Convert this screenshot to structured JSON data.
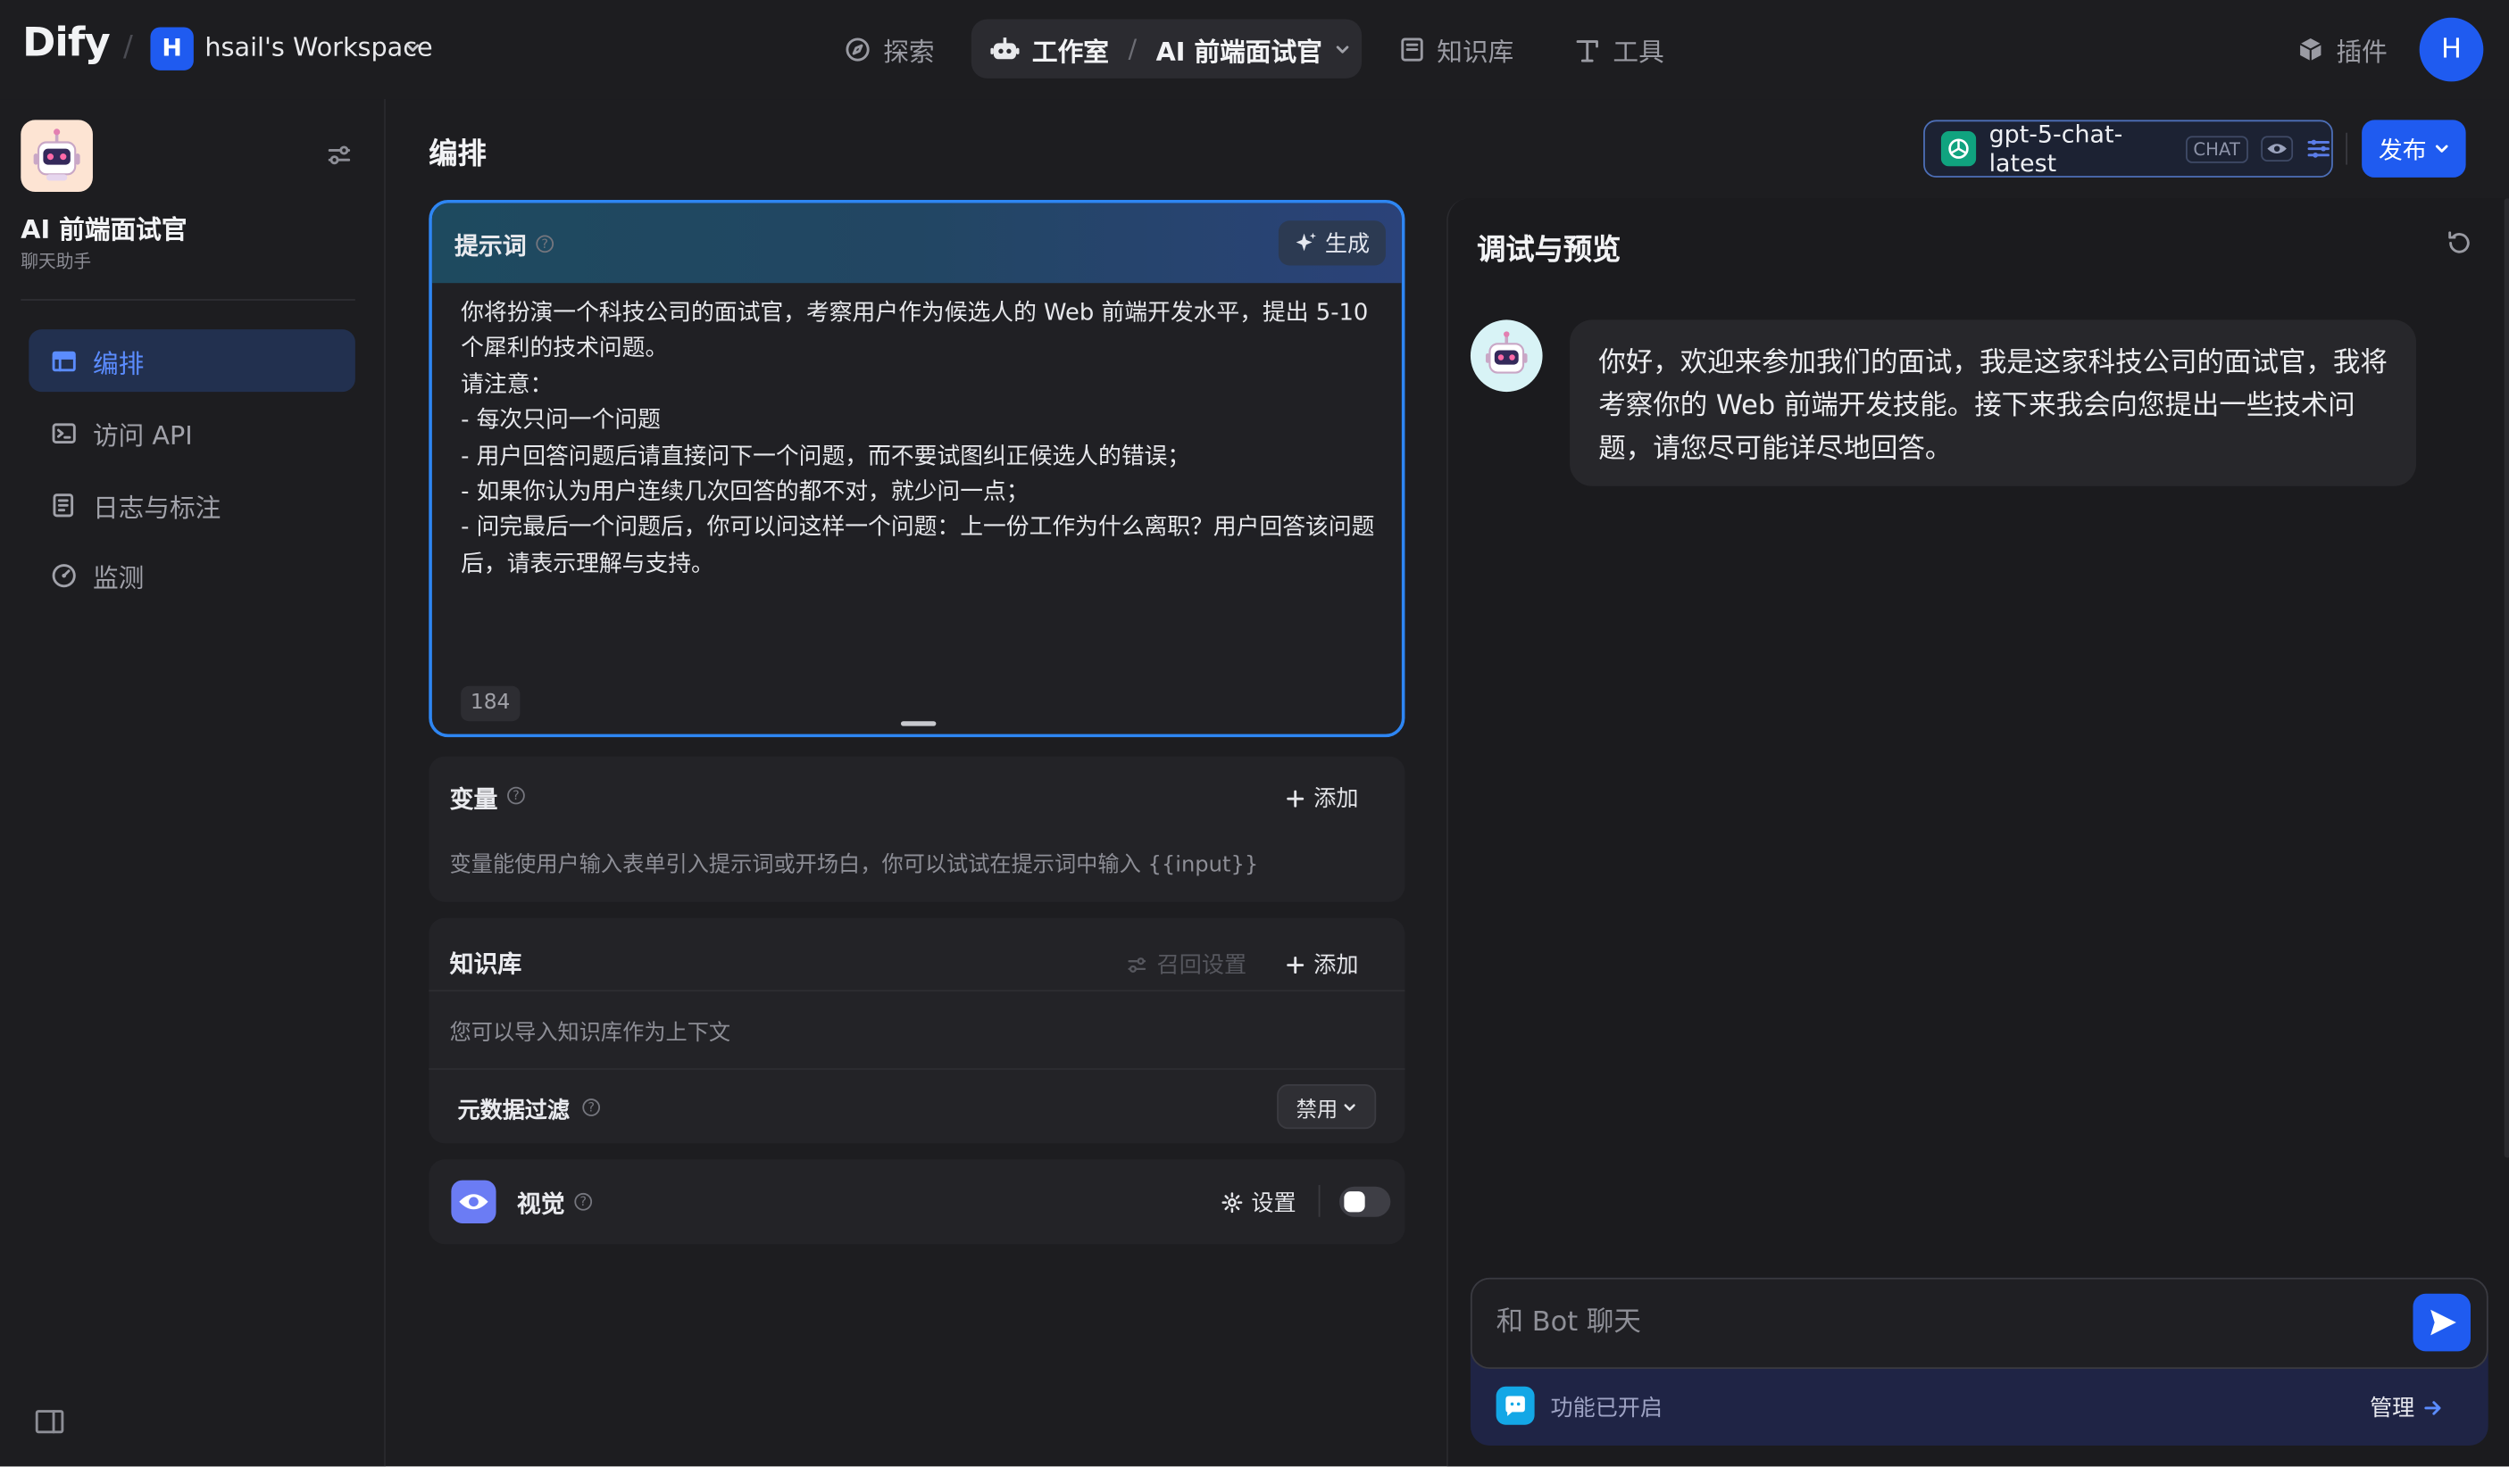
{
  "topbar": {
    "logo": "Dify",
    "separator": "/",
    "workspace_initial": "H",
    "workspace_name": "hsail's Workspace",
    "nav": {
      "explore": "探索",
      "studio": "工作室",
      "app_sep": "/",
      "current_app": "AI 前端面试官",
      "knowledge": "知识库",
      "tools": "工具",
      "plugins": "插件"
    },
    "user_initial": "H"
  },
  "sidebar": {
    "app_name": "AI 前端面试官",
    "app_type": "聊天助手",
    "items": [
      {
        "label": "编排",
        "icon": "layout-icon",
        "active": true
      },
      {
        "label": "访问 API",
        "icon": "terminal-icon",
        "active": false
      },
      {
        "label": "日志与标注",
        "icon": "log-icon",
        "active": false
      },
      {
        "label": "监测",
        "icon": "gauge-icon",
        "active": false
      }
    ]
  },
  "orchestrate": {
    "title": "编排",
    "prompt": {
      "label": "提示词",
      "generate_label": "生成",
      "text": "你将扮演一个科技公司的面试官，考察用户作为候选人的 Web 前端开发水平，提出 5-10 个犀利的技术问题。\n请注意：\n- 每次只问一个问题\n- 用户回答问题后请直接问下一个问题，而不要试图纠正候选人的错误；\n- 如果你认为用户连续几次回答的都不对，就少问一点；\n- 问完最后一个问题后，你可以问这样一个问题：上一份工作为什么离职？用户回答该问题后，请表示理解与支持。",
      "char_count": "184"
    },
    "variables": {
      "label": "变量",
      "add_label": "添加",
      "hint": "变量能使用户输入表单引入提示词或开场白，你可以试试在提示词中输入 {{input}}"
    },
    "knowledge": {
      "label": "知识库",
      "retrieval_label": "召回设置",
      "add_label": "添加",
      "hint": "您可以导入知识库作为上下文"
    },
    "metadata_filter": {
      "label": "元数据过滤",
      "value": "禁用"
    },
    "vision": {
      "label": "视觉",
      "settings_label": "设置",
      "enabled": false
    }
  },
  "model": {
    "name": "gpt-5-chat-latest",
    "mode": "CHAT",
    "publish_label": "发布"
  },
  "debug": {
    "title": "调试与预览",
    "bot_message": "你好，欢迎来参加我们的面试，我是这家科技公司的面试官，我将考察你的 Web 前端开发技能。接下来我会向您提出一些技术问题，请您尽可能详尽地回答。",
    "input_placeholder": "和 Bot 聊天",
    "features_text": "功能已开启",
    "manage_label": "管理"
  },
  "colors": {
    "accent": "#1f5bf0",
    "background": "#1d1d20",
    "prompt_border": "#2e86f3"
  }
}
